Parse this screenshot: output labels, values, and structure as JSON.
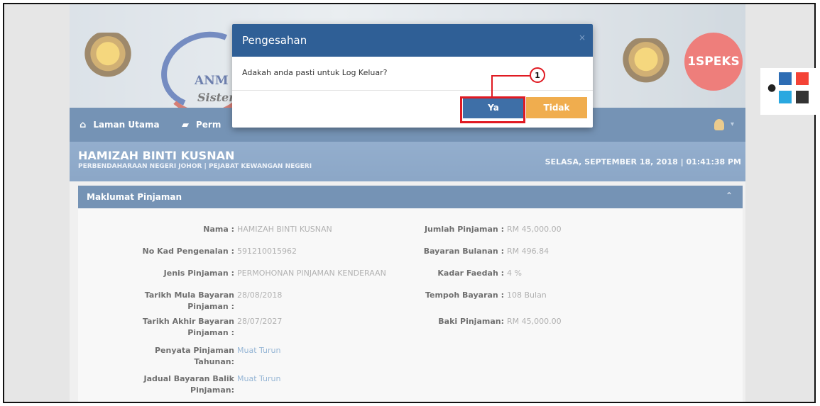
{
  "header": {
    "logo_text": "ANM",
    "logo_subtext": "Sisten",
    "brand_badge": "1SPEKS"
  },
  "nav": {
    "items": [
      {
        "label": "Laman Utama",
        "icon": "home-icon"
      },
      {
        "label": "Perm",
        "icon": "book-icon"
      }
    ]
  },
  "user_info": {
    "name": "HAMIZAH BINTI KUSNAN",
    "department": "PERBENDAHARAAN NEGERI JOHOR | PEJABAT KEWANGAN NEGERI",
    "datetime": "SELASA, SEPTEMBER 18, 2018 | 01:41:38 PM"
  },
  "panel": {
    "title": "Maklumat Pinjaman",
    "left_fields": [
      {
        "label": "Nama :",
        "value": "HAMIZAH BINTI KUSNAN"
      },
      {
        "label": "No Kad Pengenalan :",
        "value": "591210015962"
      },
      {
        "label": "Jenis Pinjaman :",
        "value": "PERMOHONAN PINJAMAN KENDERAAN"
      },
      {
        "label_line1": "Tarikh Mula Bayaran",
        "label_line2": "Pinjaman :",
        "value": "28/08/2018"
      },
      {
        "label_line1": "Tarikh Akhir Bayaran",
        "label_line2": "Pinjaman :",
        "value": "28/07/2027"
      },
      {
        "label_line1": "Penyata Pinjaman",
        "label_line2": "Tahunan:",
        "value": "Muat Turun"
      },
      {
        "label_line1": "Jadual Bayaran Balik",
        "label_line2": "Pinjaman:",
        "value": "Muat Turun"
      }
    ],
    "right_fields": [
      {
        "label": "Jumlah Pinjaman :",
        "value": "RM 45,000.00"
      },
      {
        "label": "Bayaran Bulanan :",
        "value": "RM 496.84"
      },
      {
        "label": "Kadar Faedah :",
        "value": "4 %"
      },
      {
        "label": "Tempoh Bayaran :",
        "value": "108 Bulan"
      },
      {
        "label": "Baki Pinjaman:",
        "value": "RM 45,000.00"
      }
    ]
  },
  "modal": {
    "title": "Pengesahan",
    "close_glyph": "×",
    "message": "Adakah anda pasti untuk Log Keluar?",
    "yes_label": "Ya",
    "no_label": "Tidak"
  },
  "callout": {
    "number": "1"
  },
  "theme_colors": [
    "#2e6db4",
    "#f44336",
    "#29a8e0",
    "#333333"
  ]
}
